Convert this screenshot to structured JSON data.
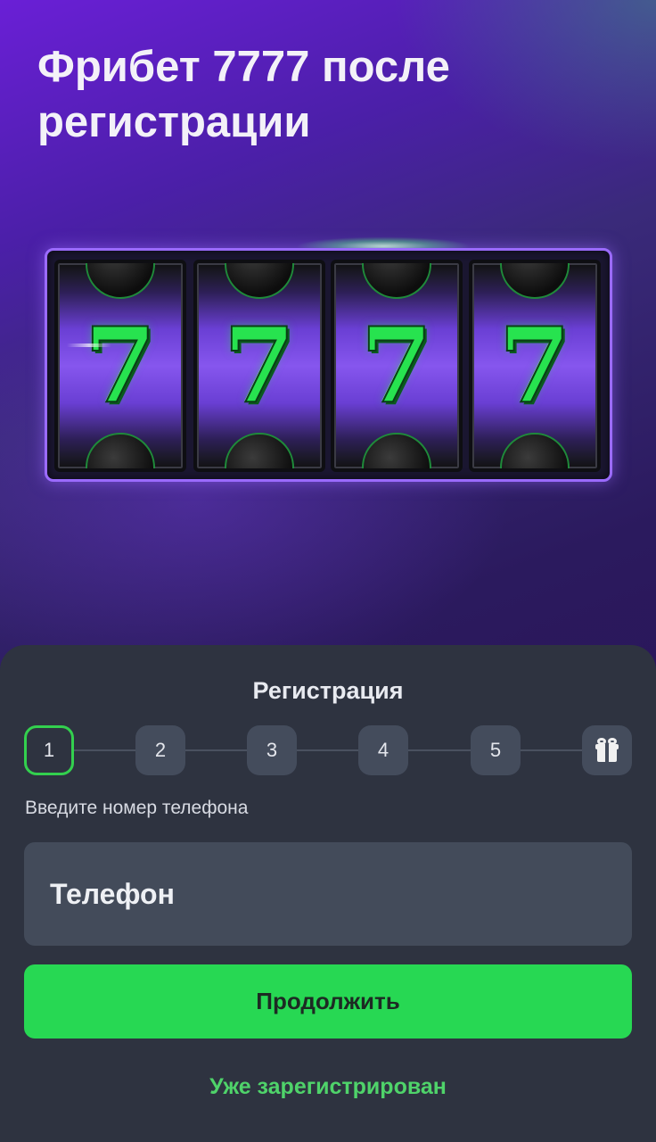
{
  "hero": {
    "title": "Фрибет 7777 после регистрации"
  },
  "slot_machine": {
    "reels": [
      {
        "symbol": "7"
      },
      {
        "symbol": "7"
      },
      {
        "symbol": "7"
      },
      {
        "symbol": "7"
      }
    ]
  },
  "registration": {
    "title": "Регистрация",
    "steps": [
      {
        "label": "1",
        "active": true
      },
      {
        "label": "2",
        "active": false
      },
      {
        "label": "3",
        "active": false
      },
      {
        "label": "4",
        "active": false
      },
      {
        "label": "5",
        "active": false
      },
      {
        "label": "",
        "icon": "gift-icon",
        "active": false
      }
    ],
    "hint": "Введите номер телефона",
    "phone_placeholder": "Телефон",
    "continue_label": "Продолжить",
    "already_registered_label": "Уже зарегистрирован"
  },
  "colors": {
    "accent_green": "#27d853",
    "sheet_bg": "#2e3340",
    "field_bg": "#434b5a",
    "slot_border": "#9b6bff"
  }
}
